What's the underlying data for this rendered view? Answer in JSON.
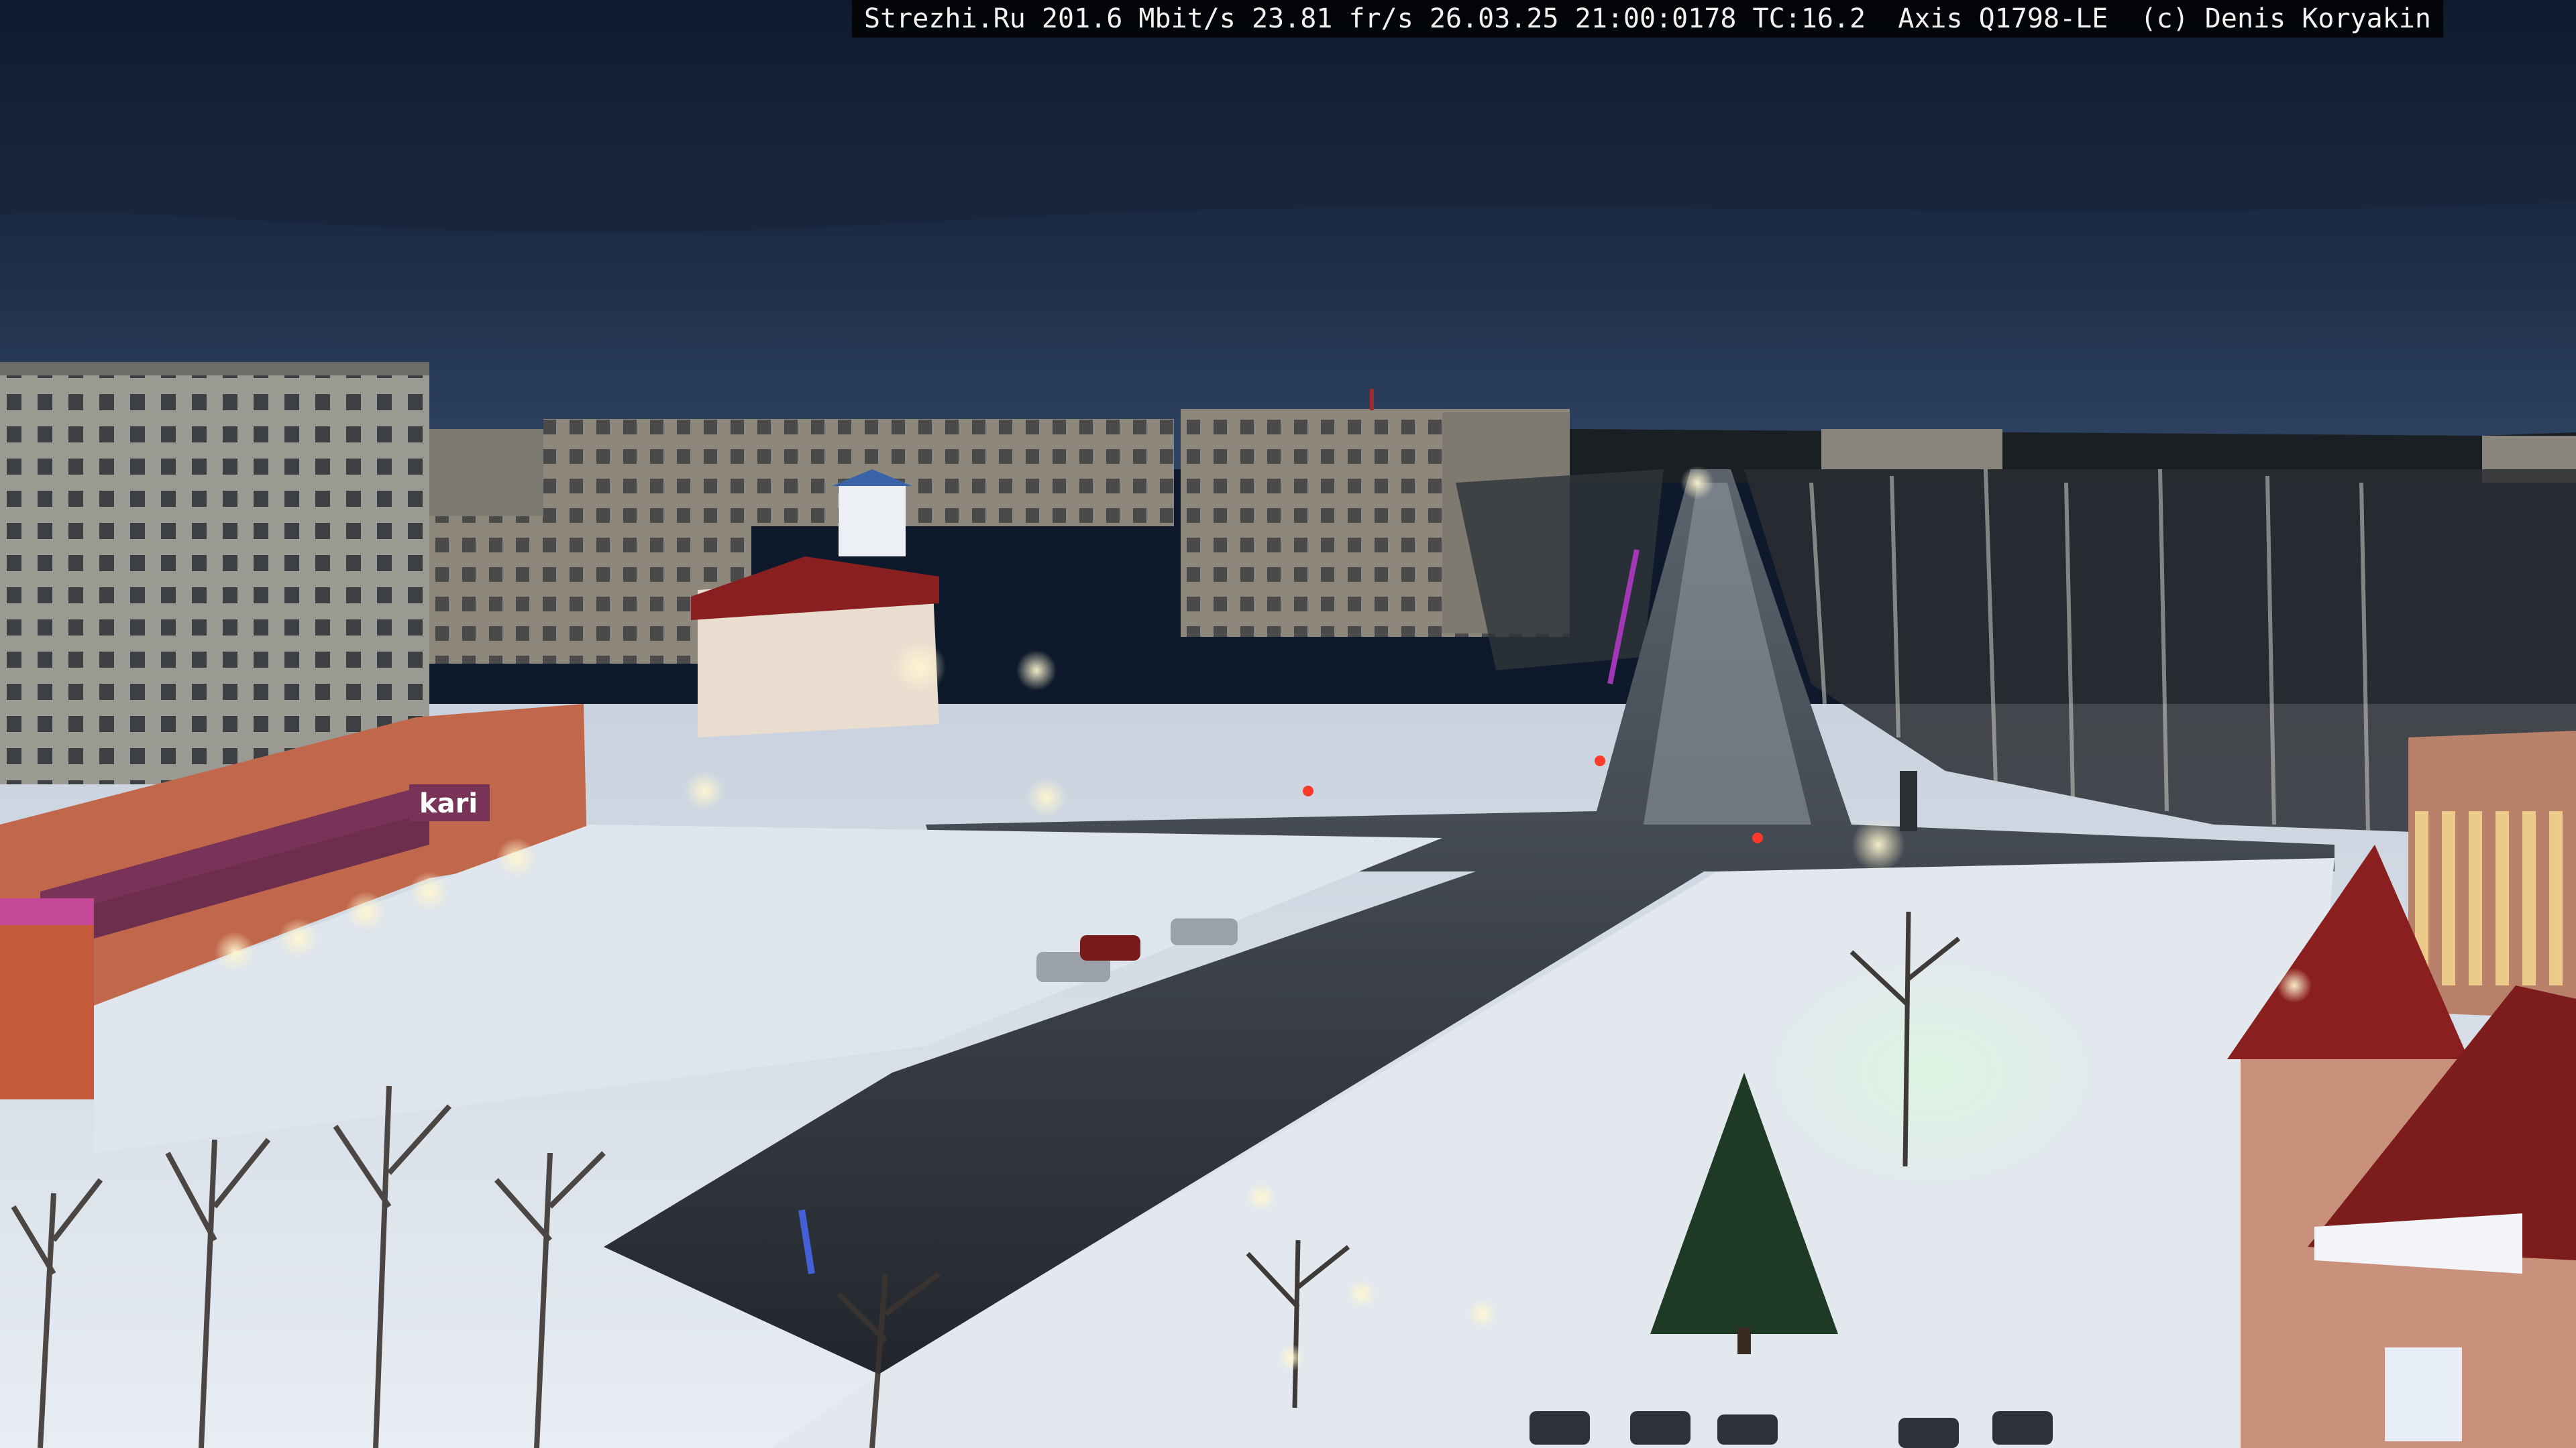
{
  "overlay": {
    "text": "Strezhi.Ru 201.6 Mbit/s 23.81 fr/s 26.03.25 21:00:0178 TC:16.2  Axis Q1798-LE  (c) Denis Koryakin"
  },
  "signage": {
    "store_logo": "kari"
  },
  "colors": {
    "sky_top": "#0f1a2e",
    "sky_horizon": "#2a3f5f",
    "snow": "#dfe6ef",
    "road": "#2b2f36",
    "street_light": "#fff3c4",
    "neon_violet": "#c43bd6",
    "roof_red": "#8a1f1f"
  }
}
